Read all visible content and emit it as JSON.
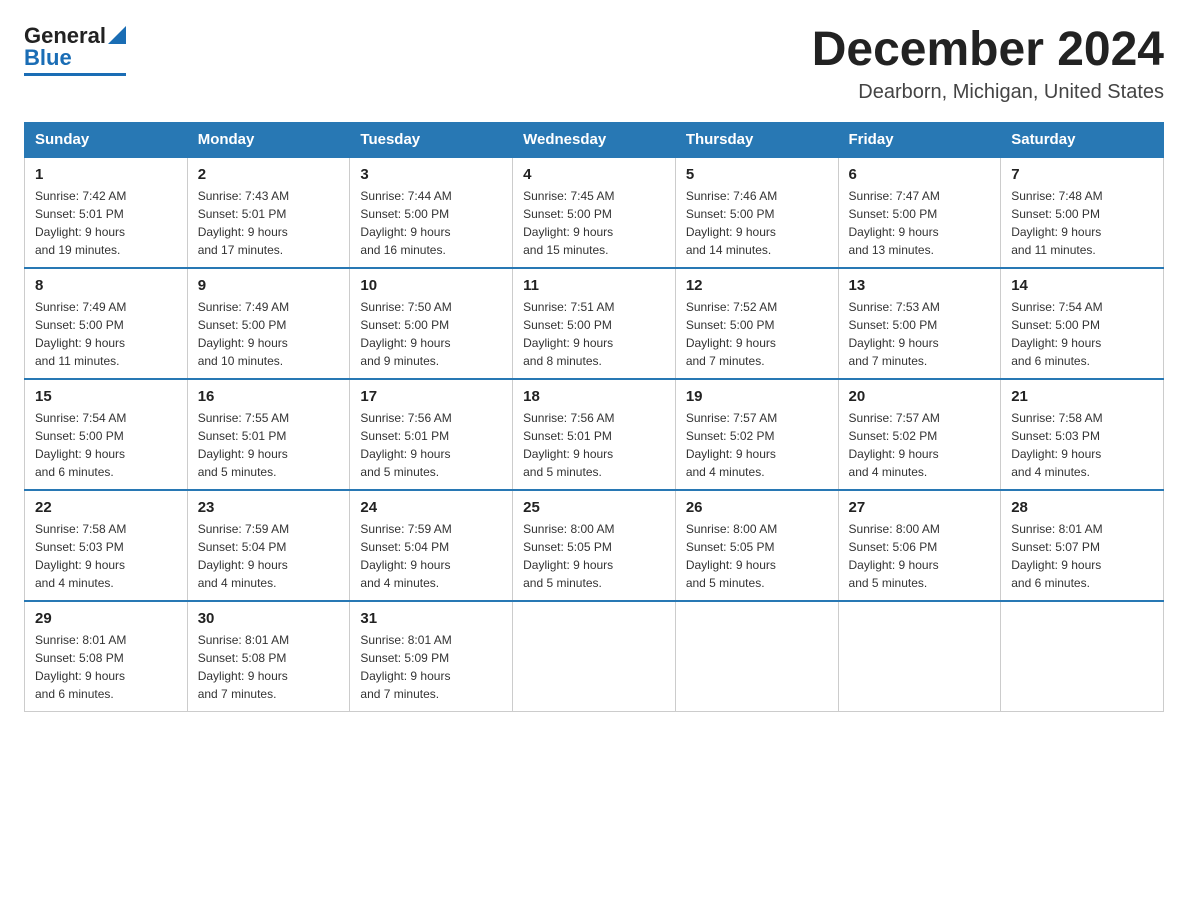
{
  "header": {
    "logo": {
      "general": "General",
      "blue": "Blue",
      "triangle_alt": "triangle logo"
    },
    "title": "December 2024",
    "location": "Dearborn, Michigan, United States"
  },
  "calendar": {
    "weekdays": [
      "Sunday",
      "Monday",
      "Tuesday",
      "Wednesday",
      "Thursday",
      "Friday",
      "Saturday"
    ],
    "weeks": [
      [
        {
          "day": "1",
          "sunrise": "7:42 AM",
          "sunset": "5:01 PM",
          "daylight": "9 hours and 19 minutes."
        },
        {
          "day": "2",
          "sunrise": "7:43 AM",
          "sunset": "5:01 PM",
          "daylight": "9 hours and 17 minutes."
        },
        {
          "day": "3",
          "sunrise": "7:44 AM",
          "sunset": "5:00 PM",
          "daylight": "9 hours and 16 minutes."
        },
        {
          "day": "4",
          "sunrise": "7:45 AM",
          "sunset": "5:00 PM",
          "daylight": "9 hours and 15 minutes."
        },
        {
          "day": "5",
          "sunrise": "7:46 AM",
          "sunset": "5:00 PM",
          "daylight": "9 hours and 14 minutes."
        },
        {
          "day": "6",
          "sunrise": "7:47 AM",
          "sunset": "5:00 PM",
          "daylight": "9 hours and 13 minutes."
        },
        {
          "day": "7",
          "sunrise": "7:48 AM",
          "sunset": "5:00 PM",
          "daylight": "9 hours and 11 minutes."
        }
      ],
      [
        {
          "day": "8",
          "sunrise": "7:49 AM",
          "sunset": "5:00 PM",
          "daylight": "9 hours and 11 minutes."
        },
        {
          "day": "9",
          "sunrise": "7:49 AM",
          "sunset": "5:00 PM",
          "daylight": "9 hours and 10 minutes."
        },
        {
          "day": "10",
          "sunrise": "7:50 AM",
          "sunset": "5:00 PM",
          "daylight": "9 hours and 9 minutes."
        },
        {
          "day": "11",
          "sunrise": "7:51 AM",
          "sunset": "5:00 PM",
          "daylight": "9 hours and 8 minutes."
        },
        {
          "day": "12",
          "sunrise": "7:52 AM",
          "sunset": "5:00 PM",
          "daylight": "9 hours and 7 minutes."
        },
        {
          "day": "13",
          "sunrise": "7:53 AM",
          "sunset": "5:00 PM",
          "daylight": "9 hours and 7 minutes."
        },
        {
          "day": "14",
          "sunrise": "7:54 AM",
          "sunset": "5:00 PM",
          "daylight": "9 hours and 6 minutes."
        }
      ],
      [
        {
          "day": "15",
          "sunrise": "7:54 AM",
          "sunset": "5:00 PM",
          "daylight": "9 hours and 6 minutes."
        },
        {
          "day": "16",
          "sunrise": "7:55 AM",
          "sunset": "5:01 PM",
          "daylight": "9 hours and 5 minutes."
        },
        {
          "day": "17",
          "sunrise": "7:56 AM",
          "sunset": "5:01 PM",
          "daylight": "9 hours and 5 minutes."
        },
        {
          "day": "18",
          "sunrise": "7:56 AM",
          "sunset": "5:01 PM",
          "daylight": "9 hours and 5 minutes."
        },
        {
          "day": "19",
          "sunrise": "7:57 AM",
          "sunset": "5:02 PM",
          "daylight": "9 hours and 4 minutes."
        },
        {
          "day": "20",
          "sunrise": "7:57 AM",
          "sunset": "5:02 PM",
          "daylight": "9 hours and 4 minutes."
        },
        {
          "day": "21",
          "sunrise": "7:58 AM",
          "sunset": "5:03 PM",
          "daylight": "9 hours and 4 minutes."
        }
      ],
      [
        {
          "day": "22",
          "sunrise": "7:58 AM",
          "sunset": "5:03 PM",
          "daylight": "9 hours and 4 minutes."
        },
        {
          "day": "23",
          "sunrise": "7:59 AM",
          "sunset": "5:04 PM",
          "daylight": "9 hours and 4 minutes."
        },
        {
          "day": "24",
          "sunrise": "7:59 AM",
          "sunset": "5:04 PM",
          "daylight": "9 hours and 4 minutes."
        },
        {
          "day": "25",
          "sunrise": "8:00 AM",
          "sunset": "5:05 PM",
          "daylight": "9 hours and 5 minutes."
        },
        {
          "day": "26",
          "sunrise": "8:00 AM",
          "sunset": "5:05 PM",
          "daylight": "9 hours and 5 minutes."
        },
        {
          "day": "27",
          "sunrise": "8:00 AM",
          "sunset": "5:06 PM",
          "daylight": "9 hours and 5 minutes."
        },
        {
          "day": "28",
          "sunrise": "8:01 AM",
          "sunset": "5:07 PM",
          "daylight": "9 hours and 6 minutes."
        }
      ],
      [
        {
          "day": "29",
          "sunrise": "8:01 AM",
          "sunset": "5:08 PM",
          "daylight": "9 hours and 6 minutes."
        },
        {
          "day": "30",
          "sunrise": "8:01 AM",
          "sunset": "5:08 PM",
          "daylight": "9 hours and 7 minutes."
        },
        {
          "day": "31",
          "sunrise": "8:01 AM",
          "sunset": "5:09 PM",
          "daylight": "9 hours and 7 minutes."
        },
        null,
        null,
        null,
        null
      ]
    ]
  }
}
